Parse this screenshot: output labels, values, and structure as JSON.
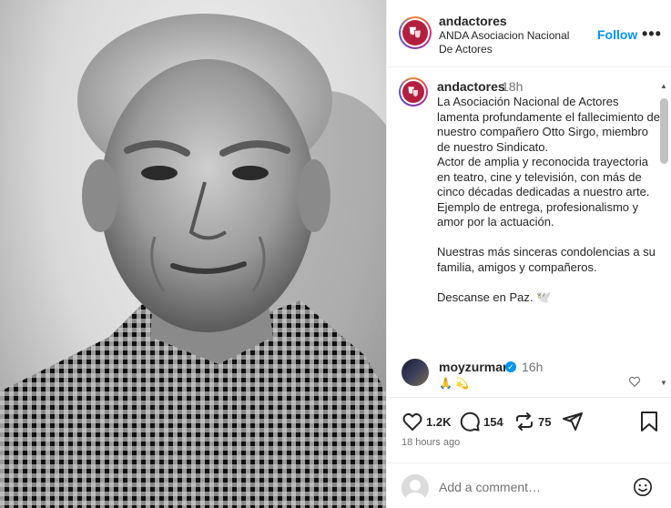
{
  "post": {
    "image_alt_subject": "black-and-white portrait"
  },
  "header": {
    "username": "andactores",
    "subtitle": "ANDA Asociacion Nacional De Actores",
    "follow_label": "Follow",
    "more_label": "•••"
  },
  "caption": {
    "username": "andactores",
    "time": "18h",
    "paragraphs": [
      "La Asociación Nacional de Actores lamenta profundamente el fallecimiento de nuestro compañero Otto Sirgo, miembro de nuestro Sindicato.",
      "Actor de amplia y reconocida trayectoria en teatro, cine y televisión, con más de cinco décadas dedicadas a nuestro arte.",
      "Ejemplo de entrega, profesionalismo y amor por la actuación.",
      "",
      "Nuestras más sinceras condolencias a su familia, amigos y compañeros.",
      "",
      "Descanse en Paz. 🕊️"
    ]
  },
  "comment": {
    "username": "moyzurman",
    "verified": true,
    "time": "16h",
    "text": "🙏 💫"
  },
  "actions": {
    "likes": "1.2K",
    "comments": "154",
    "reposts": "75"
  },
  "time_ago": "18 hours ago",
  "add_comment": {
    "placeholder": "Add a comment…"
  },
  "colors": {
    "accent": "#0095f6",
    "brand": "#b3203f",
    "text": "#262626",
    "muted": "#737373"
  }
}
